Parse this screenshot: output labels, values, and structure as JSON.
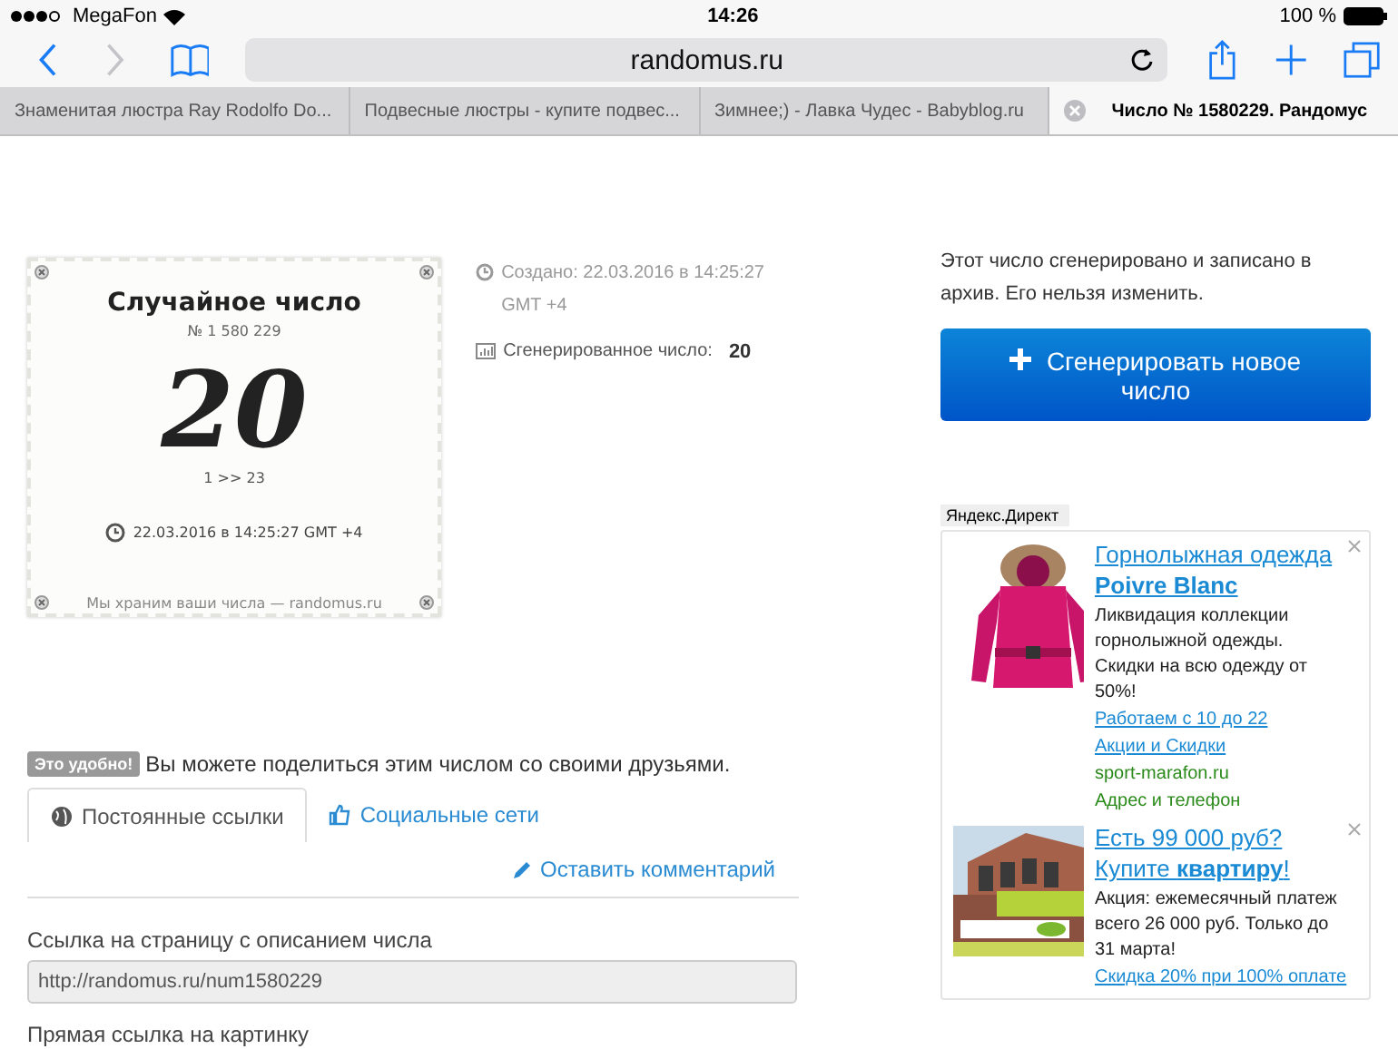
{
  "status_bar": {
    "carrier": "MegaFon",
    "time": "14:26",
    "battery": "100 %"
  },
  "toolbar": {
    "address": "randomus.ru"
  },
  "tabs": [
    {
      "label": "Знаменитая люстра Ray Rodolfo Do...",
      "selected": false
    },
    {
      "label": "Подвесные люстры - купите подвес...",
      "selected": false
    },
    {
      "label": "Зимнее;) - Лавка Чудес - Babyblog.ru",
      "selected": false
    },
    {
      "label": "Число № 1580229. Рандомус",
      "selected": true
    }
  ],
  "number_card": {
    "title": "Случайное число",
    "serial": "№  1 580 229",
    "number": "20",
    "range": "1 >> 23",
    "timestamp": "22.03.2016 в 14:25:27 GMT +4",
    "footer": "Мы храним ваши числа — randomus.ru"
  },
  "meta": {
    "created": "Создано: 22.03.2016 в 14:25:27 GMT +4",
    "generated_label": "Сгенерированное число:",
    "generated_value": "20"
  },
  "notice": "Этот число сгенерировано и записано в архив. Его нельзя изменить.",
  "generate_button": "Сгенерировать новое число",
  "ads": {
    "label": "Яндекс.Директ",
    "items": [
      {
        "title": "Горнолыжная одежда **Poivre Blanc**",
        "text": "Ликвидация коллекции горнолыжной одежды. Скидки на всю одежду от 50%!",
        "links": [
          "Работаем с 10 до 22",
          "Акции и Скидки"
        ],
        "domain": "sport-marafon.ru",
        "contact": "Адрес и телефон"
      },
      {
        "title": "Есть 99 000 руб? Купите **квартиру**!",
        "text": "Акция: ежемесячный платеж всего 26 000 руб. Только до 31 марта!",
        "links": [
          "Скидка 20% при 100% оплате"
        ]
      }
    ]
  },
  "share": {
    "badge": "Это удобно!",
    "text": "Вы можете поделиться этим числом со своими друзьями.",
    "tabs": [
      {
        "label": "Постоянные ссылки",
        "selected": true
      },
      {
        "label": "Социальные сети",
        "selected": false
      }
    ],
    "comment_link": "Оставить комментарий",
    "fields": [
      {
        "label": "Ссылка на страницу с описанием числа",
        "value": "http://randomus.ru/num1580229"
      }
    ],
    "next_label": "Прямая ссылка на картинку"
  }
}
